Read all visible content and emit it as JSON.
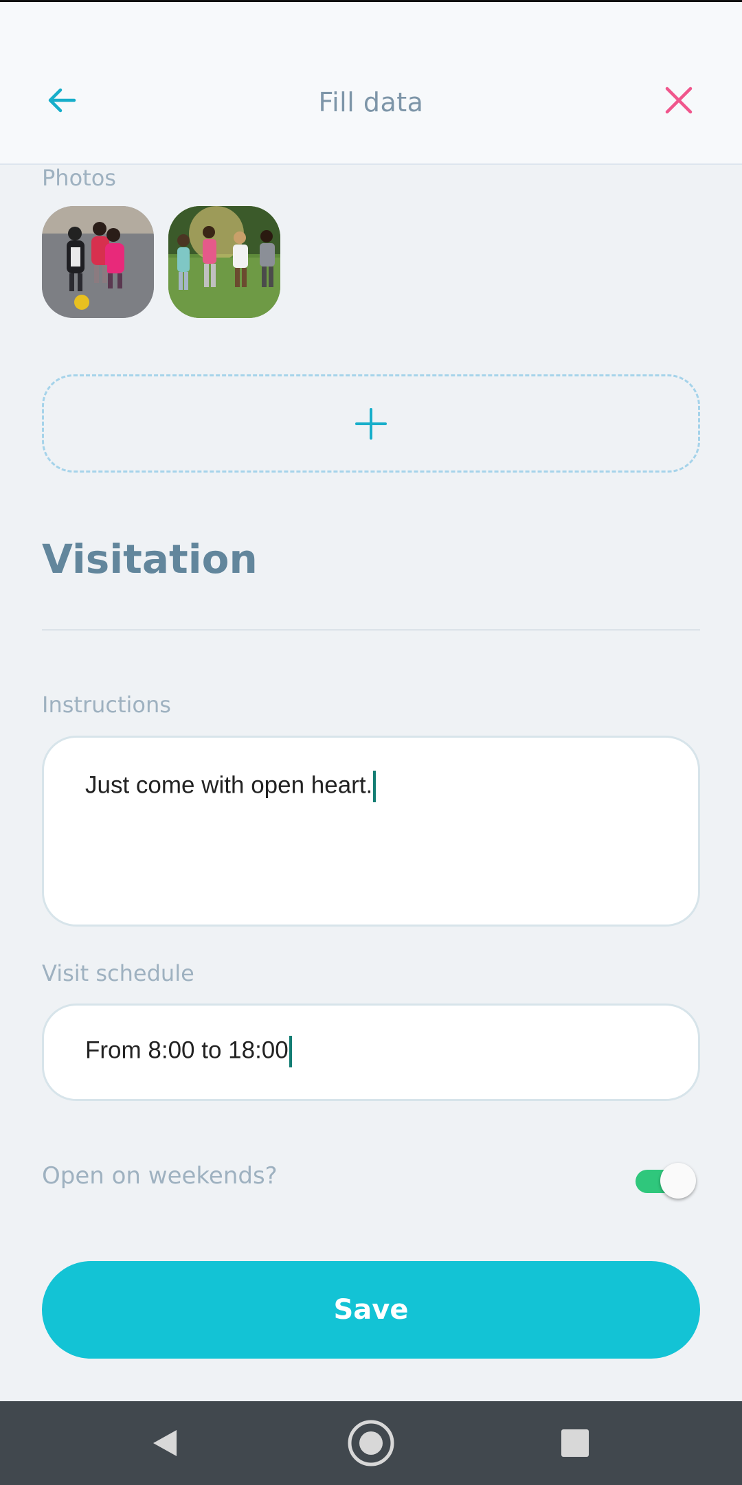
{
  "header": {
    "title": "Fill data",
    "back_icon": "arrow-left-icon",
    "close_icon": "close-icon"
  },
  "photos": {
    "label": "Photos",
    "items": [
      {
        "description_icon": "photo-thumbnail"
      },
      {
        "description_icon": "photo-thumbnail"
      }
    ],
    "add_icon": "plus-icon"
  },
  "visitation": {
    "title": "Visitation",
    "instructions": {
      "label": "Instructions",
      "value": "Just come with open heart."
    },
    "schedule": {
      "label": "Visit schedule",
      "value": "From 8:00 to 18:00"
    },
    "weekends": {
      "label": "Open on weekends?",
      "enabled": true
    }
  },
  "save_label": "Save",
  "colors": {
    "accent": "#13c3d5",
    "close": "#f0568c",
    "toggle_on": "#2fc77c",
    "title": "#62869c"
  },
  "nav": [
    "back-triangle-icon",
    "home-circle-icon",
    "recents-square-icon"
  ]
}
